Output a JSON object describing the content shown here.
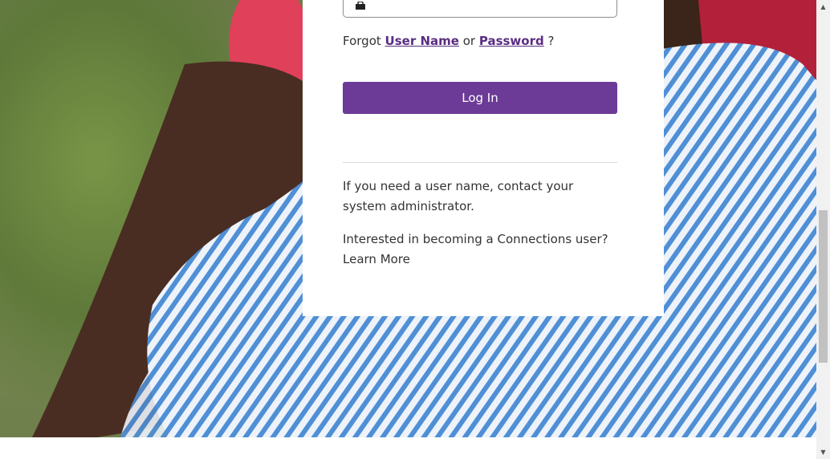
{
  "login_form": {
    "forgot_prefix": "Forgot",
    "forgot_username_link": "User Name",
    "forgot_or": "or",
    "forgot_password_link": "Password",
    "forgot_suffix": "?",
    "login_button_label": "Log In",
    "help_text": "If you need a user name, contact your system administrator.",
    "interest_text": "Interested in becoming a Connections user?",
    "learn_more_link": "Learn More"
  },
  "colors": {
    "brand_purple": "#6c3b97",
    "link_purple": "#5a2d82"
  },
  "icons": {
    "password_field_icon": "lock-icon",
    "scroll_up": "triangle-up-icon",
    "scroll_down": "triangle-down-icon"
  }
}
